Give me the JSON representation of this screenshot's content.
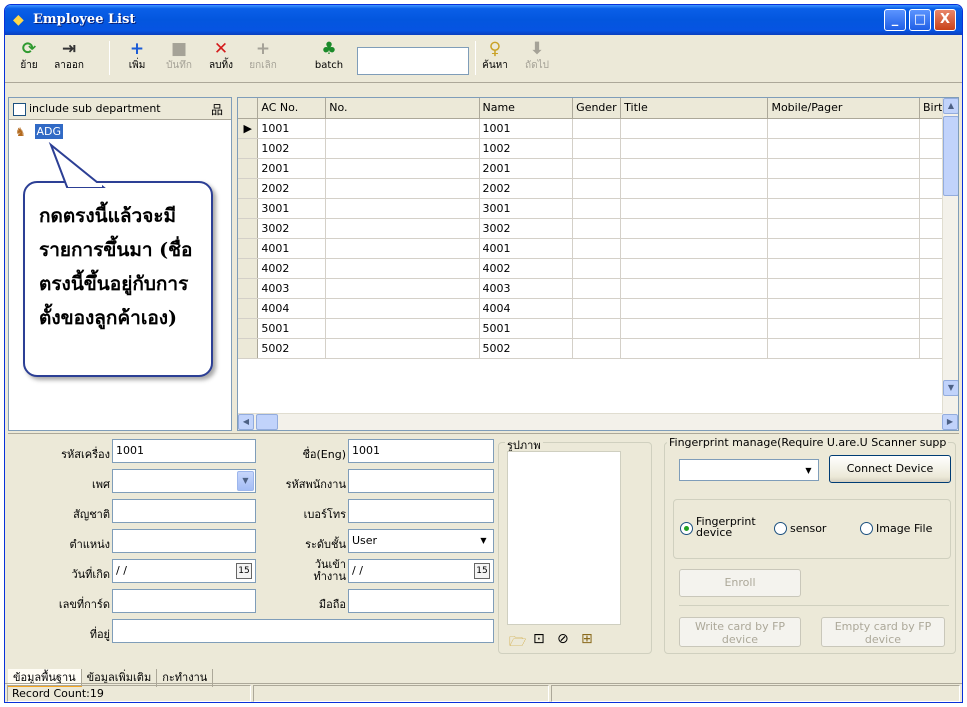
{
  "window": {
    "title": "Employee List",
    "buttons": {
      "minimize": "_",
      "maximize": "□",
      "close": "X"
    }
  },
  "toolbar": {
    "move": "ย้าย",
    "leave": "ลาออก",
    "add": "เพิ่ม",
    "save": "บันทึก",
    "delete": "ลบทิ้ง",
    "cancel": "ยกเลิก",
    "batch": "batch",
    "search_value": "",
    "find": "ค้นหา",
    "next": "ถัดไป"
  },
  "left_panel": {
    "include_sub_label": "include sub department",
    "tree_node": "ADG"
  },
  "callout": {
    "lines": [
      "กดตรงนี้แล้วจะมี",
      "รายการขึ้นมา (ชื่อ",
      "ตรงนี้ขึ้นอยู่กับการ",
      "ตั้งของลูกค้าเอง)"
    ]
  },
  "grid": {
    "headers": [
      "AC No.",
      "No.",
      "Name",
      "Gender",
      "Title",
      "Mobile/Pager",
      "Birt"
    ],
    "rows": [
      [
        "1001",
        "",
        "1001",
        "",
        "",
        "",
        ""
      ],
      [
        "1002",
        "",
        "1002",
        "",
        "",
        "",
        ""
      ],
      [
        "2001",
        "",
        "2001",
        "",
        "",
        "",
        ""
      ],
      [
        "2002",
        "",
        "2002",
        "",
        "",
        "",
        ""
      ],
      [
        "3001",
        "",
        "3001",
        "",
        "",
        "",
        ""
      ],
      [
        "3002",
        "",
        "3002",
        "",
        "",
        "",
        ""
      ],
      [
        "4001",
        "",
        "4001",
        "",
        "",
        "",
        ""
      ],
      [
        "4002",
        "",
        "4002",
        "",
        "",
        "",
        ""
      ],
      [
        "4003",
        "",
        "4003",
        "",
        "",
        "",
        ""
      ],
      [
        "4004",
        "",
        "4004",
        "",
        "",
        "",
        ""
      ],
      [
        "5001",
        "",
        "5001",
        "",
        "",
        "",
        ""
      ],
      [
        "5002",
        "",
        "5002",
        "",
        "",
        "",
        ""
      ]
    ]
  },
  "form": {
    "device_code_label": "รหัสเครื่อง",
    "device_code": "1001",
    "gender_label": "เพศ",
    "gender": "",
    "nationality_label": "สัญชาติ",
    "nationality": "",
    "position_label": "ตำแหน่ง",
    "position": "",
    "birthdate_label": "วันที่เกิด",
    "birthdate": "/ /",
    "card_label": "เลขที่การ์ด",
    "card": "",
    "address_label": "ที่อยู่",
    "address": "",
    "name_eng_label": "ชื่อ(Eng)",
    "name_eng": "1001",
    "employee_id_label": "รหัสพนักงาน",
    "employee_id": "",
    "phone_label": "เบอร์โทร",
    "phone": "",
    "level_label": "ระดับชั้น",
    "level": "User",
    "start_date_label": "วันเข้าทำงาน",
    "start_date": "/ /",
    "mobile_label": "มือถือ",
    "mobile": "",
    "photo_label": "รูปภาพ"
  },
  "fingerprint": {
    "group_title": "Fingerprint manage(Require U.are.U Scanner supp",
    "connect_button": "Connect Device",
    "radio_device_top": "Fingerprint",
    "radio_device_bottom": "device",
    "radio_sensor": "sensor",
    "radio_image": "Image File",
    "enroll_button": "Enroll",
    "write_card_line1": "Write card by FP",
    "write_card_line2": "device",
    "empty_card_line1": "Empty card by FP",
    "empty_card_line2": "device"
  },
  "tabs": [
    "ข้อมูลพื้นฐาน",
    "ข้อมูลเพิ่มเติม",
    "กะทำงาน"
  ],
  "status": {
    "record_count": "Record Count:19"
  },
  "colors": {
    "title_bar": "#0356de",
    "window_bg": "#ece9d8",
    "selection": "#316ac5",
    "callout_border": "#2c3f95"
  }
}
